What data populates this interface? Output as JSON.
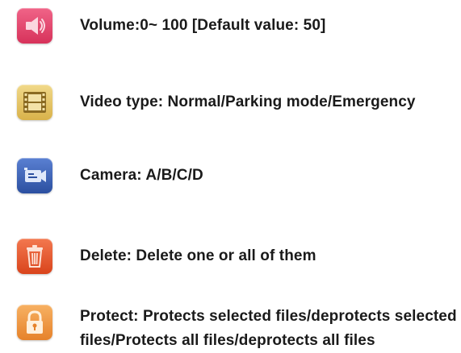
{
  "colors": {
    "volume_icon_bg": "#e8456a",
    "video_icon_bg": "#e6c766",
    "camera_icon_bg": "#3c63b8",
    "delete_icon_bg": "#ea5a2e",
    "protect_icon_bg": "#f29a42"
  },
  "items": [
    {
      "icon": "speaker-icon",
      "text": "Volume:0~ 100 [Default value: 50]"
    },
    {
      "icon": "film-icon",
      "text": "Video type: Normal/Parking mode/Emergency"
    },
    {
      "icon": "video-camera-icon",
      "text": "Camera: A/B/C/D"
    },
    {
      "icon": "trash-icon",
      "text": "Delete: Delete one or all of them"
    },
    {
      "icon": "lock-icon",
      "text": "Protect: Protects selected files/deprotects selected files/Protects all files/deprotects all files"
    }
  ]
}
